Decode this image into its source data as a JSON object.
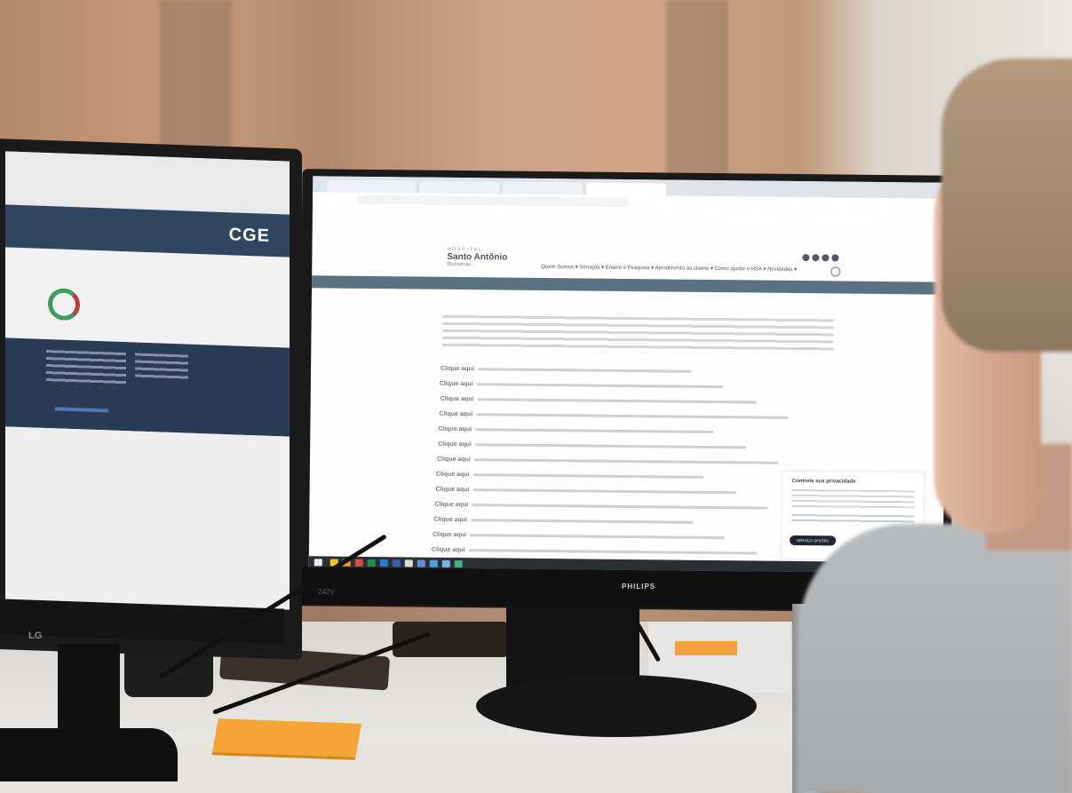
{
  "left_monitor": {
    "logo": "CGE",
    "brand": "LG"
  },
  "main_monitor": {
    "brand": "PHILIPS",
    "model": "242V",
    "browser": {
      "tabs": [
        "",
        "",
        "",
        ""
      ],
      "url": "",
      "bookmarks": ""
    },
    "site": {
      "logo_small": "HOSPITAL",
      "logo_big": "Santo Antônio",
      "logo_sub": "Blumenau",
      "menu": "Quem Somos ▾   Serviços ▾   Ensino e Pesquisa ▾   Atendimento ao cliente ▾   Como ajudar o HSA ▾   Novidades ▾",
      "rows_label": "Clique aqui",
      "row_count": 13,
      "privacy": {
        "title": "Controle sua privacidade",
        "button": "SERVIÇO OPÇÕES"
      }
    }
  },
  "colors": {
    "site_band": "#5a7182",
    "left_band": "#2f4560",
    "sticky_note": "#f5a436"
  }
}
